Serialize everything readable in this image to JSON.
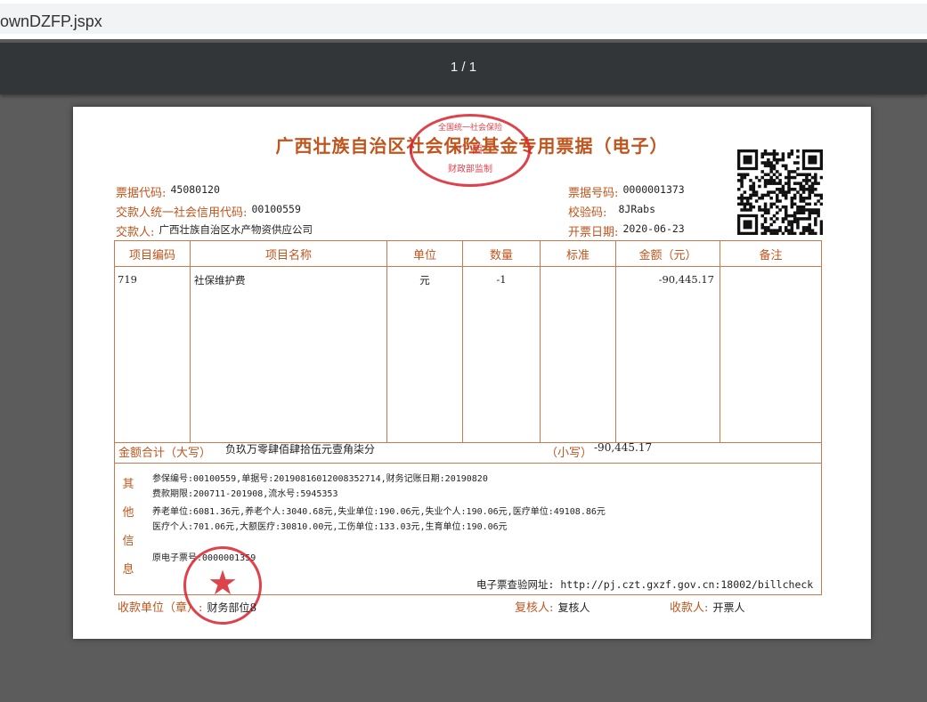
{
  "browser": {
    "url_fragment": "ownDZFP.jspx"
  },
  "viewer": {
    "page_indicator": "1 / 1"
  },
  "doc": {
    "title": "广西壮族自治区社会保险基金专用票据（电子）",
    "header": {
      "code_label": "票据代码:",
      "code_value": "45080120",
      "payer_credit_label": "交款人统一社会信用代码:",
      "payer_credit_value": "00100559",
      "payer_label": "交款人:",
      "payer_value": "广西壮族自治区水产物资供应公司",
      "number_label": "票据号码:",
      "number_value": "0000001373",
      "check_label": "校验码:",
      "check_value": "8JRabs",
      "date_label": "开票日期:",
      "date_value": "2020-06-23"
    },
    "table": {
      "headers": [
        "项目编码",
        "项目名称",
        "单位",
        "数量",
        "标准",
        "金额（元）",
        "备注"
      ],
      "row": {
        "code": "719",
        "name": "社保维护费",
        "unit": "元",
        "qty": "-1",
        "std": "",
        "amount": "-90,445.17",
        "note": ""
      }
    },
    "totals": {
      "upper_label": "金额合计（大写）",
      "upper_value": "负玖万零肆佰肆拾伍元壹角柒分",
      "lower_label": "（小写）",
      "lower_value": "-90,445.17"
    },
    "other": {
      "side_chars": [
        "其",
        "他",
        "信",
        "息"
      ],
      "lines": [
        "参保编号:00100559,单据号:20190816012008352714,财务记账日期:20190820",
        "费款期限:200711-201908,流水号:5945353",
        "养老单位:6081.36元,养老个人:3040.68元,失业单位:190.06元,失业个人:190.06元,医疗单位:49108.86元",
        "医疗个人:701.06元,大额医疗:30810.00元,工伤单位:133.03元,生育单位:190.06元"
      ],
      "orig_label": "原电子票号:",
      "orig_value": "0000001359",
      "verify_url": "电子票查验网址: http://pj.czt.gxzf.gov.cn:18002/billcheck"
    },
    "footer": {
      "payee_label": "收款单位（章）:",
      "payee_value": "财务部位8",
      "reviewer_label": "复核人:",
      "reviewer_value": "复核人",
      "cashier_label": "收款人:",
      "cashier_value": "开票人"
    },
    "seals": {
      "top_seal_text_top": "全国统一社会保险",
      "top_seal_text_mid": "广 西",
      "top_seal_text_bottom": "财政部监制",
      "bottom_seal_star": "★"
    },
    "colors": {
      "accent": "#c0551e",
      "seal": "#d9232d",
      "toolbar": "#323639",
      "backdrop": "#5c5c5c"
    }
  }
}
